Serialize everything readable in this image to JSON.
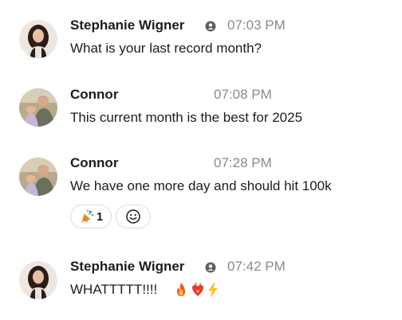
{
  "messages": [
    {
      "author": "Stephanie Wigner",
      "time": "07:03 PM",
      "text": "What is your last record month?",
      "avatar": "stephanie-avatar"
    },
    {
      "author": "Connor",
      "time": "07:08 PM",
      "text": "This current month is the best for 2025",
      "avatar": "connor-avatar"
    },
    {
      "author": "Connor",
      "time": "07:28 PM",
      "text": "We have one more day and should hit 100k",
      "avatar": "connor-avatar",
      "reactions": [
        {
          "emoji": "party-popper-icon",
          "count": "1"
        },
        {
          "emoji": "add-reaction-icon"
        }
      ]
    },
    {
      "author": "Stephanie Wigner",
      "time": "07:42 PM",
      "text": "WHATTTTT!!!!",
      "avatar": "stephanie-avatar",
      "trailing_emojis": [
        "fire-icon",
        "heart-on-fire-icon",
        "lightning-icon"
      ]
    }
  ],
  "colors": {
    "text": "#1d1c1d",
    "timestamp": "#8a8a8a",
    "reaction_border": "#dcdcdc"
  }
}
